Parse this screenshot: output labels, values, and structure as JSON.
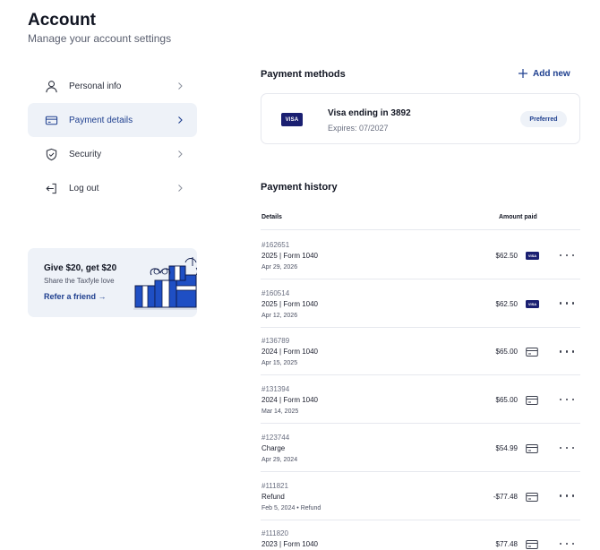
{
  "header": {
    "title": "Account",
    "subtitle": "Manage your account settings"
  },
  "sidebar": {
    "items": [
      {
        "label": "Personal info",
        "icon": "user-icon",
        "active": false
      },
      {
        "label": "Payment details",
        "icon": "credit-card-icon",
        "active": true
      },
      {
        "label": "Security",
        "icon": "shield-icon",
        "active": false
      },
      {
        "label": "Log out",
        "icon": "logout-icon",
        "active": false
      }
    ]
  },
  "promo": {
    "title": "Give $20, get $20",
    "subtitle": "Share the Taxfyle love",
    "link": "Refer a friend →",
    "art_icon": "gift-boxes-illustration"
  },
  "payment_methods": {
    "title": "Payment methods",
    "add_label": "Add new",
    "card": {
      "brand": "VISA",
      "name": "Visa ending in 3892",
      "expires": "Expires: 07/2027",
      "badge": "Preferred"
    }
  },
  "payment_history": {
    "title": "Payment history",
    "columns": {
      "details": "Details",
      "amount": "Amount paid"
    },
    "rows": [
      {
        "id": "#162651",
        "desc": "2025 | Form 1040",
        "date": "Apr 29, 2026",
        "amount": "$62.50",
        "method": "visa"
      },
      {
        "id": "#160514",
        "desc": "2025 | Form 1040",
        "date": "Apr 12, 2026",
        "amount": "$62.50",
        "method": "visa"
      },
      {
        "id": "#136789",
        "desc": "2024 | Form 1040",
        "date": "Apr 15, 2025",
        "amount": "$65.00",
        "method": "card"
      },
      {
        "id": "#131394",
        "desc": "2024 | Form 1040",
        "date": "Mar 14, 2025",
        "amount": "$65.00",
        "method": "card"
      },
      {
        "id": "#123744",
        "desc": "Charge",
        "date": "Apr 29, 2024",
        "amount": "$54.99",
        "method": "card"
      },
      {
        "id": "#111821",
        "desc": "Refund",
        "date": "Feb 5, 2024 • Refund",
        "amount": "-$77.48",
        "method": "card"
      },
      {
        "id": "#111820",
        "desc": "2023 | Form 1040",
        "date": "",
        "amount": "$77.48",
        "method": "card"
      }
    ]
  },
  "colors": {
    "accent": "#1e3f8f",
    "visa": "#1a1f71",
    "active_bg": "#eef2f8"
  }
}
